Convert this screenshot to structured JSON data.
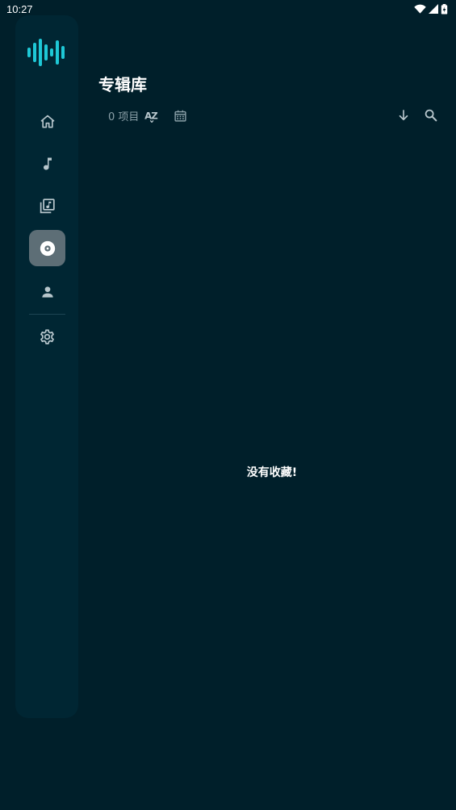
{
  "status_bar": {
    "time": "10:27"
  },
  "sidebar": {
    "items": [
      {
        "id": "home",
        "icon": "home-icon",
        "active": false
      },
      {
        "id": "songs",
        "icon": "music-note-icon",
        "active": false
      },
      {
        "id": "playlists",
        "icon": "library-music-icon",
        "active": false
      },
      {
        "id": "albums",
        "icon": "album-icon",
        "active": true
      },
      {
        "id": "artists",
        "icon": "person-icon",
        "active": false
      },
      {
        "id": "settings",
        "icon": "gear-icon",
        "active": false
      }
    ]
  },
  "header": {
    "title": "专辑库"
  },
  "toolbar": {
    "item_count": "0 项目",
    "icons": [
      "sort-az-icon",
      "calendar-icon",
      "arrow-down-icon",
      "search-icon"
    ]
  },
  "content": {
    "empty_message": "没有收藏!"
  },
  "colors": {
    "background": "#001f2a",
    "rail": "#002633",
    "active_item": "#5d6e76",
    "accent": "#1ec8d6",
    "icon": "#b7c6cc",
    "muted_text": "#8aa0a8"
  }
}
